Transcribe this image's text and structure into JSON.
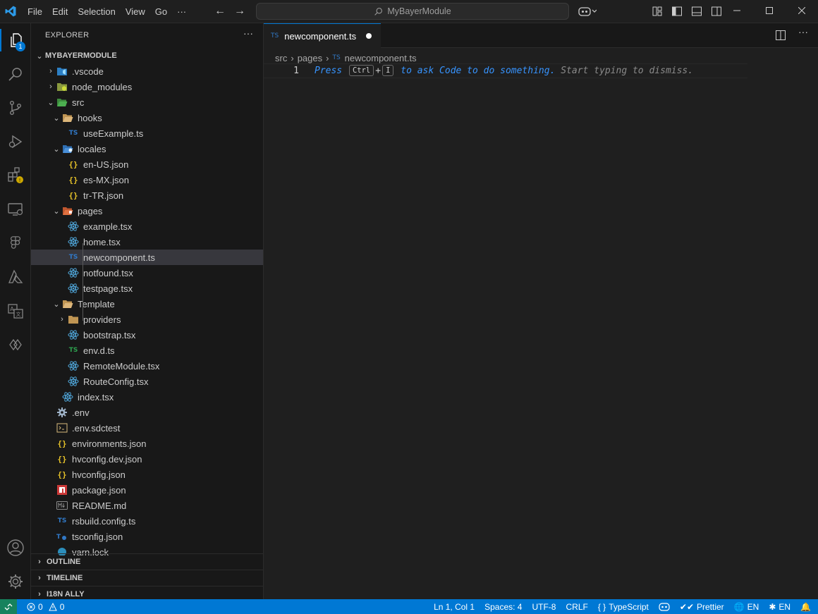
{
  "titlebar": {
    "menu": [
      "File",
      "Edit",
      "Selection",
      "View",
      "Go",
      "···"
    ],
    "search_text": "MyBayerModule"
  },
  "activity": {
    "explorer_badge": "1"
  },
  "explorer": {
    "title": "EXPLORER",
    "more": "···",
    "root_label": "MYBAYERMODULE",
    "items": [
      {
        "label": ".vscode",
        "icon": "vscode-folder",
        "level": 0,
        "chevron": "›"
      },
      {
        "label": "node_modules",
        "icon": "node-folder",
        "level": 0,
        "chevron": "›"
      },
      {
        "label": "src",
        "icon": "src-folder",
        "level": 0,
        "chevron": "⌄"
      },
      {
        "label": "hooks",
        "icon": "folder-open",
        "level": 1,
        "chevron": "⌄"
      },
      {
        "label": "useExample.ts",
        "icon": "ts",
        "level": 2
      },
      {
        "label": "locales",
        "icon": "locales-folder",
        "level": 1,
        "chevron": "⌄"
      },
      {
        "label": "en-US.json",
        "icon": "json",
        "level": 2
      },
      {
        "label": "es-MX.json",
        "icon": "json",
        "level": 2
      },
      {
        "label": "tr-TR.json",
        "icon": "json",
        "level": 2
      },
      {
        "label": "pages",
        "icon": "pages-folder",
        "level": 1,
        "chevron": "⌄"
      },
      {
        "label": "example.tsx",
        "icon": "react",
        "level": 2
      },
      {
        "label": "home.tsx",
        "icon": "react",
        "level": 2
      },
      {
        "label": "newcomponent.ts",
        "icon": "ts",
        "level": 2,
        "selected": true
      },
      {
        "label": "notfound.tsx",
        "icon": "react",
        "level": 2
      },
      {
        "label": "testpage.tsx",
        "icon": "react",
        "level": 2
      },
      {
        "label": "Template",
        "icon": "folder-open",
        "level": 1,
        "chevron": "⌄"
      },
      {
        "label": "providers",
        "icon": "folder",
        "level": 2,
        "chevron": "›"
      },
      {
        "label": "bootstrap.tsx",
        "icon": "react",
        "level": 2
      },
      {
        "label": "env.d.ts",
        "icon": "tsd",
        "level": 2
      },
      {
        "label": "RemoteModule.tsx",
        "icon": "react",
        "level": 2
      },
      {
        "label": "RouteConfig.tsx",
        "icon": "react",
        "level": 2
      },
      {
        "label": "index.tsx",
        "icon": "react",
        "level": 1
      },
      {
        "label": ".env",
        "icon": "gear",
        "level": 0
      },
      {
        "label": ".env.sdctest",
        "icon": "env",
        "level": 0
      },
      {
        "label": "environments.json",
        "icon": "json",
        "level": 0
      },
      {
        "label": "hvconfig.dev.json",
        "icon": "json",
        "level": 0
      },
      {
        "label": "hvconfig.json",
        "icon": "json",
        "level": 0
      },
      {
        "label": "package.json",
        "icon": "npm",
        "level": 0
      },
      {
        "label": "README.md",
        "icon": "md",
        "level": 0
      },
      {
        "label": "rsbuild.config.ts",
        "icon": "ts",
        "level": 0
      },
      {
        "label": "tsconfig.json",
        "icon": "tsconfig",
        "level": 0
      },
      {
        "label": "yarn.lock",
        "icon": "yarn",
        "level": 0
      }
    ],
    "panels": [
      "OUTLINE",
      "TIMELINE",
      "I18N ALLY"
    ]
  },
  "editor": {
    "tab_label": "newcomponent.ts",
    "tab_icon": "TS",
    "breadcrumbs": [
      "src",
      "pages",
      "newcomponent.ts"
    ],
    "line_number": "1",
    "hint_press": "Press",
    "hint_key1": "Ctrl",
    "hint_plus": "+",
    "hint_key2": "I",
    "hint_blue": "to ask Code to do something.",
    "hint_rest": "Start typing to dismiss."
  },
  "statusbar": {
    "errors": "0",
    "warnings": "0",
    "position": "Ln 1, Col 1",
    "spaces": "Spaces: 4",
    "encoding": "UTF-8",
    "eol": "CRLF",
    "language": "TypeScript",
    "prettier": "Prettier",
    "lang1": "EN",
    "lang2": "EN"
  },
  "colors": {
    "accent": "#0078d4",
    "remote": "#16825d",
    "ts": "#3178c6",
    "json": "#e6c229",
    "react": "#4fa5d8"
  }
}
